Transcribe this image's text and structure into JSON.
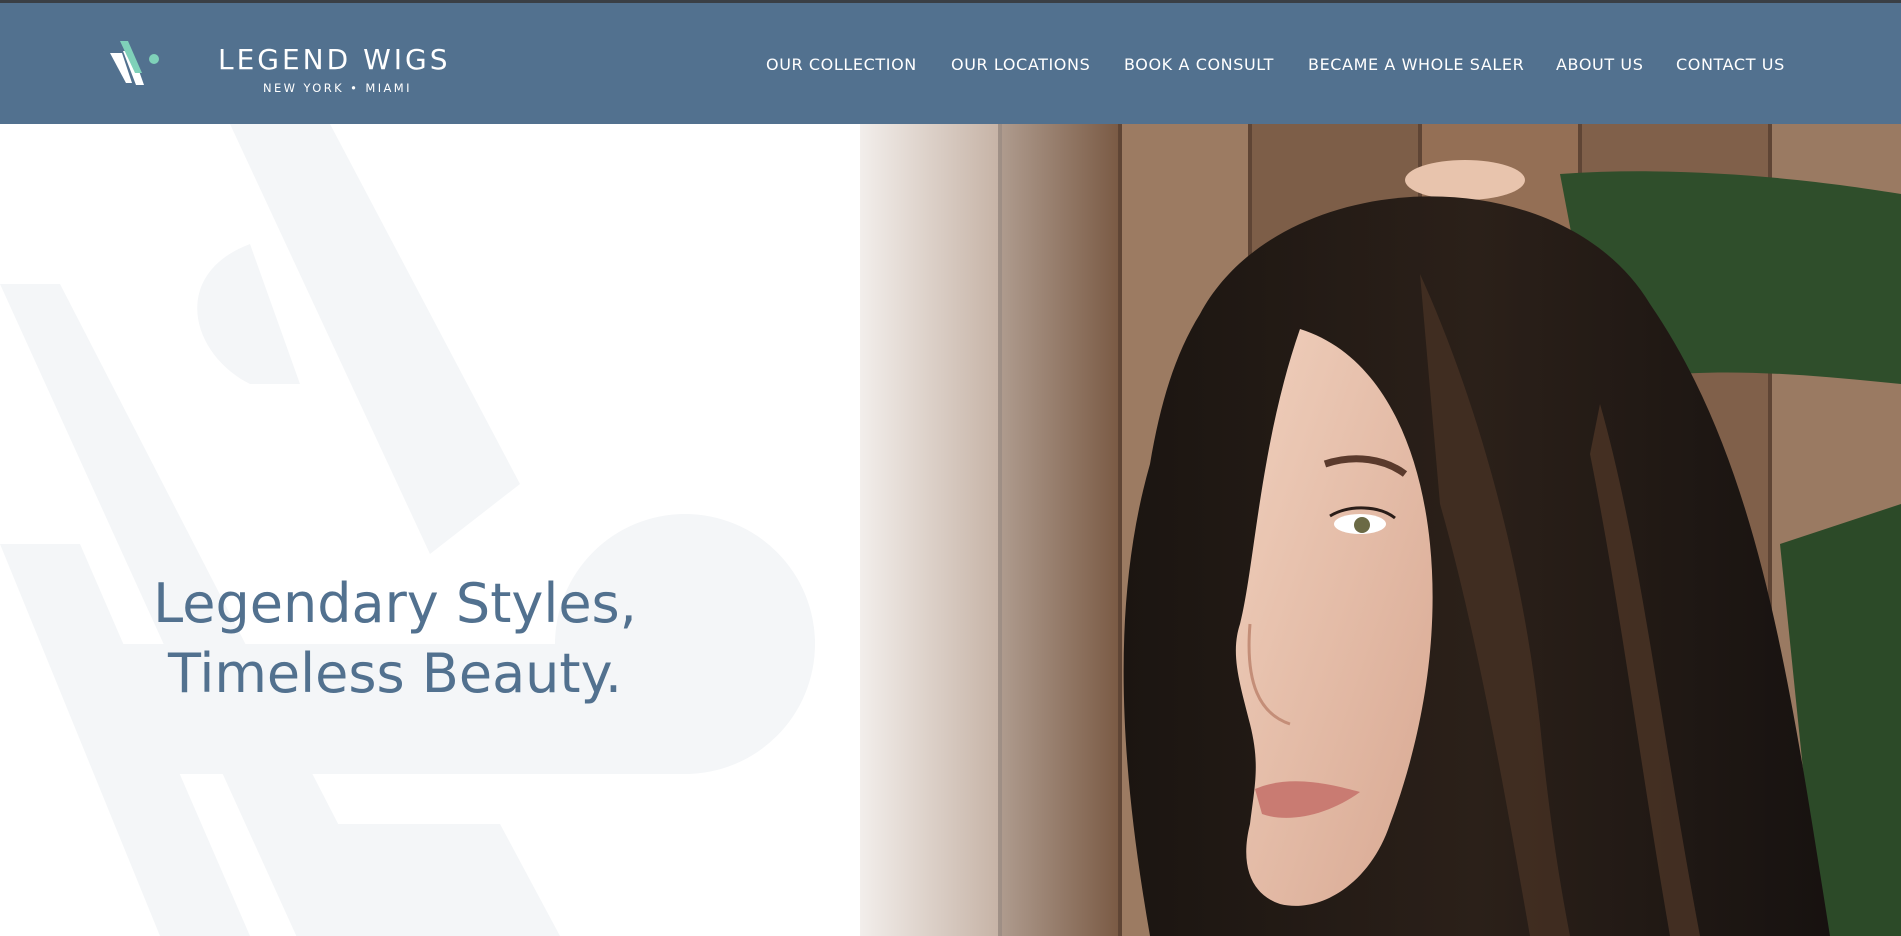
{
  "brand": {
    "name": "LEGEND WIGS",
    "tagline": "NEW YORK • MIAMI",
    "logo_colors": {
      "accent": "#7fd1b9",
      "light": "#ffffff"
    }
  },
  "nav": {
    "items": [
      {
        "label": "OUR COLLECTION"
      },
      {
        "label": "OUR LOCATIONS"
      },
      {
        "label": "BOOK A CONSULT"
      },
      {
        "label": "BECAME A WHOLE SALER"
      },
      {
        "label": "ABOUT US"
      },
      {
        "label": "CONTACT US"
      }
    ]
  },
  "hero": {
    "headline_line1": "Legendary Styles,",
    "headline_line2": "Timeless Beauty.",
    "image": "portrait-photo-woman-dark-wavy-hair",
    "colors": {
      "headline": "#52718f",
      "watermark": "#f4f6f8"
    }
  },
  "colors": {
    "header_bg": "#52718f",
    "page_bg": "#ffffff"
  }
}
